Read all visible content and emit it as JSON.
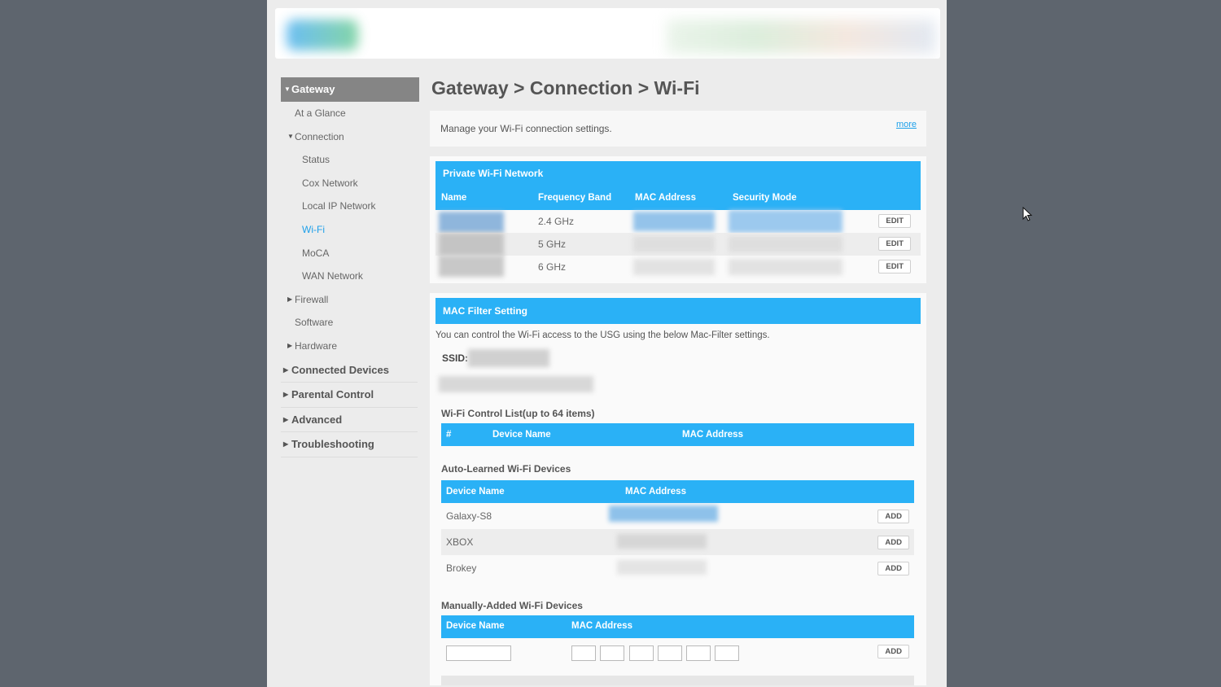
{
  "breadcrumb": "Gateway > Connection > Wi-Fi",
  "sidebar": {
    "gateway": "Gateway",
    "at_a_glance": "At a Glance",
    "connection": "Connection",
    "status": "Status",
    "cox_network": "Cox Network",
    "local_ip_network": "Local IP Network",
    "wifi": "Wi-Fi",
    "moca": "MoCA",
    "wan_network": "WAN Network",
    "firewall": "Firewall",
    "software": "Software",
    "hardware": "Hardware",
    "connected_devices": "Connected Devices",
    "parental_control": "Parental Control",
    "advanced": "Advanced",
    "troubleshooting": "Troubleshooting"
  },
  "info": {
    "text": "Manage your Wi-Fi connection settings.",
    "more": "more"
  },
  "private_wifi": {
    "title": "Private Wi-Fi Network",
    "columns": [
      "Name",
      "Frequency Band",
      "MAC Address",
      "Security Mode"
    ],
    "rows": [
      {
        "band": "2.4 GHz",
        "action": "EDIT"
      },
      {
        "band": "5 GHz",
        "action": "EDIT"
      },
      {
        "band": "6 GHz",
        "action": "EDIT"
      }
    ]
  },
  "mac_filter": {
    "title": "MAC Filter Setting",
    "description": "You can control the Wi-Fi access to the USG using the below Mac-Filter settings.",
    "ssid_label": "SSID:",
    "control_list_label": "Wi-Fi Control List(up to 64 items)",
    "control_list_columns": [
      "#",
      "Device Name",
      "MAC Address"
    ],
    "auto_learned_label": "Auto-Learned Wi-Fi Devices",
    "auto_learned_columns": [
      "Device Name",
      "MAC Address"
    ],
    "auto_learned_rows": [
      {
        "name": "Galaxy-S8",
        "action": "ADD"
      },
      {
        "name": "XBOX",
        "action": "ADD"
      },
      {
        "name": "Brokey",
        "action": "ADD"
      }
    ],
    "manual_label": "Manually-Added Wi-Fi Devices",
    "manual_columns": [
      "Device Name",
      "MAC Address"
    ],
    "manual_action": "ADD"
  },
  "colors": {
    "accent": "#2ab1f6",
    "link": "#1ea0ea",
    "sidebar_active": "#858585",
    "backdrop": "#5e656e"
  }
}
